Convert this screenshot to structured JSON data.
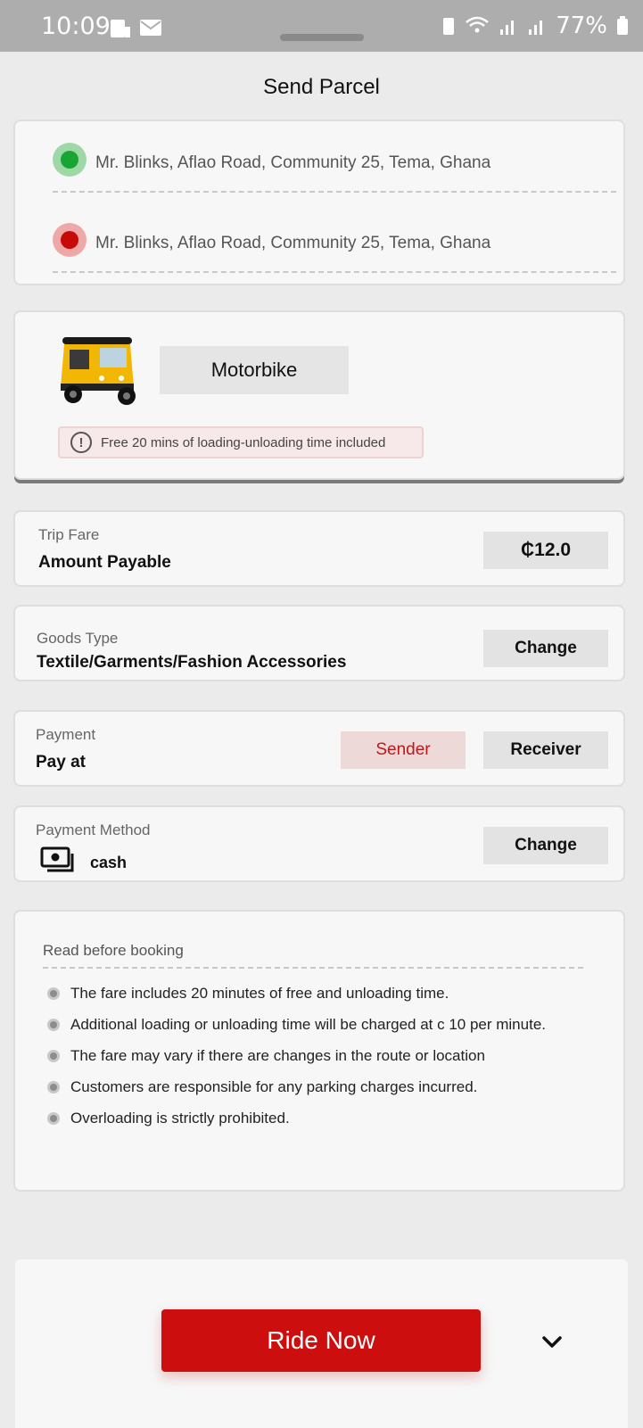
{
  "status_bar": {
    "time": "10:09",
    "battery": "77%"
  },
  "header": {
    "title": "Send Parcel"
  },
  "route": {
    "pickup": "Mr. Blinks, Aflao Road, Community 25, Tema, Ghana",
    "dropoff": "Mr. Blinks, Aflao Road, Community 25, Tema, Ghana"
  },
  "vehicle": {
    "name": "Motorbike",
    "note": "Free 20 mins of loading-unloading time included"
  },
  "fare": {
    "label": "Trip Fare",
    "value_label": "Amount Payable",
    "amount": "₵12.0"
  },
  "goods": {
    "label": "Goods Type",
    "value": "Textile/Garments/Fashion Accessories",
    "change_label": "Change"
  },
  "payment": {
    "label": "Payment",
    "value": "Pay at",
    "sender_label": "Sender",
    "receiver_label": "Receiver",
    "selected": "Sender"
  },
  "payment_method": {
    "label": "Payment Method",
    "value": "cash",
    "change_label": "Change"
  },
  "rules": {
    "title": "Read before booking",
    "items": [
      "The fare includes 20 minutes of free and unloading time.",
      "Additional loading or unloading time will  be charged at c 10 per minute.",
      "The fare may vary if there are changes in the route or location",
      "Customers are responsible for any parking charges incurred.",
      "Overloading is strictly prohibited."
    ]
  },
  "footer": {
    "ride_now_label": "Ride Now"
  },
  "colors": {
    "accent_red": "#cc0e0e",
    "pickup_green": "#19a533",
    "dropoff_red": "#c60a0a"
  }
}
